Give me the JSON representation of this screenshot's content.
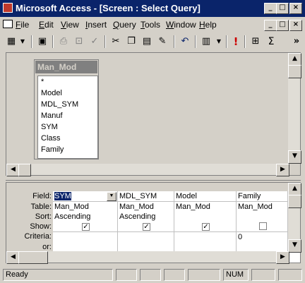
{
  "window": {
    "title": "Microsoft Access - [Screen : Select Query]",
    "controls": [
      "_",
      "□",
      "×"
    ]
  },
  "menu": {
    "items": [
      {
        "label": "File"
      },
      {
        "label": "Edit"
      },
      {
        "label": "View"
      },
      {
        "label": "Insert"
      },
      {
        "label": "Query"
      },
      {
        "label": "Tools"
      },
      {
        "label": "Window"
      },
      {
        "label": "Help"
      }
    ]
  },
  "toolbar": {
    "icons": [
      "datasheet-view-icon",
      "save-icon",
      "print-icon",
      "print-preview-icon",
      "spelling-icon",
      "cut-icon",
      "copy-icon",
      "paste-icon",
      "format-painter-icon",
      "undo-icon",
      "query-type-icon",
      "run-icon",
      "show-table-icon",
      "totals-icon"
    ],
    "run_glyph": "!",
    "totals_glyph": "Σ",
    "overflow_glyph": "»"
  },
  "table": {
    "name": "Man_Mod",
    "fields": [
      "*",
      "Model",
      "MDL_SYM",
      "Manuf",
      "SYM",
      "Class",
      "Family"
    ]
  },
  "grid": {
    "row_labels": [
      "Field:",
      "Table:",
      "Sort:",
      "Show:",
      "Criteria:",
      "or:"
    ],
    "columns": [
      {
        "field": "SYM",
        "table": "Man_Mod",
        "sort": "Ascending",
        "show": true,
        "criteria": "",
        "or": ""
      },
      {
        "field": "MDL_SYM",
        "table": "Man_Mod",
        "sort": "Ascending",
        "show": true,
        "criteria": "",
        "or": ""
      },
      {
        "field": "Model",
        "table": "Man_Mod",
        "sort": "",
        "show": true,
        "criteria": "",
        "or": ""
      },
      {
        "field": "Family",
        "table": "Man_Mod",
        "sort": "",
        "show": false,
        "criteria": "0",
        "or": ""
      }
    ]
  },
  "status": {
    "text": "Ready",
    "num": "NUM"
  }
}
